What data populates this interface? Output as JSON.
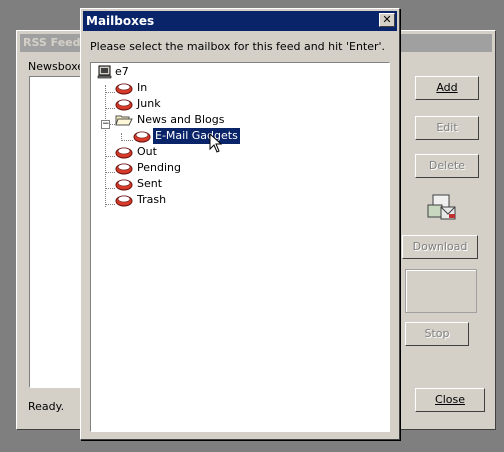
{
  "background_window": {
    "title": "RSS Feed",
    "newsbox_label": "Newsboxe",
    "status_text": "Ready.",
    "buttons": {
      "add": "Add",
      "edit": "Edit",
      "delete": "Delete",
      "download": "Download",
      "stop": "Stop",
      "close": "Close"
    }
  },
  "dialog": {
    "title": "Mailboxes",
    "close_glyph": "✕",
    "prompt": "Please select the mailbox for this feed and hit 'Enter'.",
    "tree": {
      "root": "e7",
      "items": [
        {
          "label": "In"
        },
        {
          "label": "Junk"
        },
        {
          "label": "News and Blogs",
          "expanded": true
        },
        {
          "label": "E-Mail Gadgets",
          "selected": true
        },
        {
          "label": "Out"
        },
        {
          "label": "Pending"
        },
        {
          "label": "Sent"
        },
        {
          "label": "Trash"
        }
      ],
      "expander_glyph": "−"
    }
  },
  "colors": {
    "title_active": "#0a246a",
    "selection": "#0a246a",
    "face": "#d4d0c8"
  }
}
